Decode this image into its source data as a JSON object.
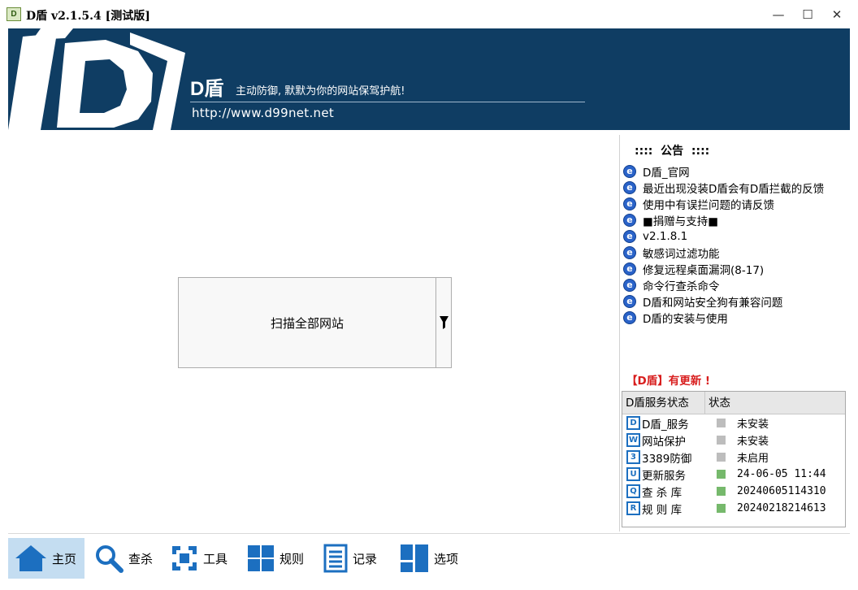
{
  "window": {
    "title": "D盾 v2.1.5.4 [测试版]",
    "icon_label": "D",
    "minimize": "—",
    "maximize": "☐",
    "close": "✕"
  },
  "banner": {
    "brand": "D盾",
    "slogan": "主动防御, 默默为你的网站保驾护航!",
    "website": "http://www.d99net.net"
  },
  "notice": {
    "title": "::::  公告  ::::",
    "items": [
      "D盾_官网",
      "最近出现没装D盾会有D盾拦截的反馈",
      "使用中有误拦问题的请反馈",
      "■捐赠与支持■",
      "v2.1.8.1",
      "敏感词过滤功能",
      "修复远程桌面漏洞(8-17)",
      "命令行查杀命令",
      "D盾和网站安全狗有兼容问题",
      "D盾的安装与使用"
    ],
    "icon_glyph": "e"
  },
  "update_notice": "【D盾】有更新 !",
  "status_table": {
    "headers": [
      "D盾服务状态",
      "状态"
    ],
    "rows": [
      {
        "icon": "D",
        "name": "D盾_服务",
        "status": "未安装",
        "state": "grey"
      },
      {
        "icon": "W",
        "name": "网站保护",
        "status": "未安装",
        "state": "grey"
      },
      {
        "icon": "3",
        "name": "3389防御",
        "status": "未启用",
        "state": "grey"
      },
      {
        "icon": "U",
        "name": "更新服务",
        "status": "24-06-05 11:44",
        "state": "green"
      },
      {
        "icon": "Q",
        "name": "查 杀 库",
        "status": "20240605114310",
        "state": "green"
      },
      {
        "icon": "R",
        "name": "规 则 库",
        "status": "20240218214613",
        "state": "green"
      }
    ]
  },
  "scan_button": {
    "label": "扫描全部网站"
  },
  "toolbar": [
    {
      "label": "主页",
      "icon": "home-icon",
      "active": true
    },
    {
      "label": "查杀",
      "icon": "magnifier-icon",
      "active": false
    },
    {
      "label": "工具",
      "icon": "tools-icon",
      "active": false
    },
    {
      "label": "规则",
      "icon": "grid-icon",
      "active": false
    },
    {
      "label": "记录",
      "icon": "log-icon",
      "active": false
    },
    {
      "label": "选项",
      "icon": "options-icon",
      "active": false
    }
  ],
  "colors": {
    "banner_bg": "#0f3d63",
    "accent_blue": "#1c6fc0",
    "update_red": "#d81e1e",
    "status_ok": "#76b96c",
    "status_off": "#bdbdbd",
    "toolbar_active": "#c4ddf1"
  }
}
